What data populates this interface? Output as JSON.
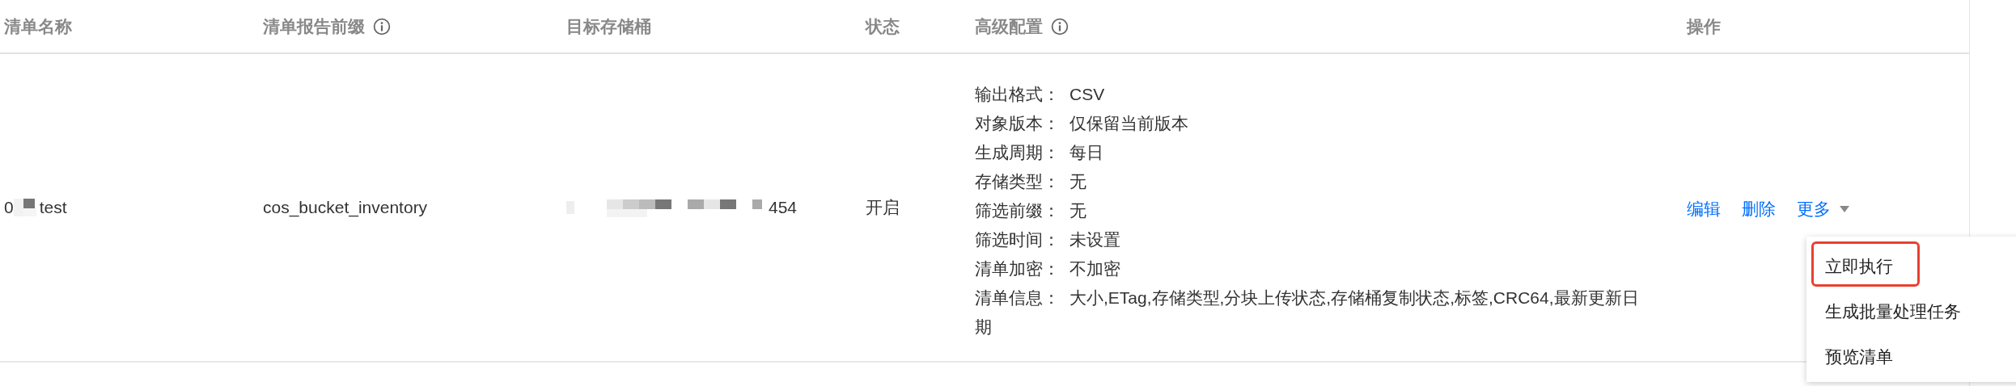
{
  "table": {
    "columns": [
      {
        "label": "清单名称",
        "info": false
      },
      {
        "label": "清单报告前缀",
        "info": true
      },
      {
        "label": "目标存储桶",
        "info": false
      },
      {
        "label": "状态",
        "info": false
      },
      {
        "label": "高级配置",
        "info": true
      },
      {
        "label": "操作",
        "info": false
      }
    ],
    "rows": [
      {
        "name": {
          "visible_start": "0",
          "visible_end": "test"
        },
        "prefix": "cos_bucket_inventory",
        "bucket": {
          "visible_end": "454"
        },
        "status": "开启",
        "config": [
          {
            "label": "输出格式：",
            "value": "CSV"
          },
          {
            "label": "对象版本：",
            "value": "仅保留当前版本"
          },
          {
            "label": "生成周期：",
            "value": "每日"
          },
          {
            "label": "存储类型：",
            "value": "无"
          },
          {
            "label": "筛选前缀：",
            "value": "无"
          },
          {
            "label": "筛选时间：",
            "value": "未设置"
          },
          {
            "label": "清单加密：",
            "value": "不加密"
          },
          {
            "label": "清单信息：",
            "value": "大小,ETag,存储类型,分块上传状态,存储桶复制状态,标签,CRC64,最新更新日期"
          }
        ],
        "actions": [
          {
            "label": "编辑",
            "kind": "link"
          },
          {
            "label": "删除",
            "kind": "link"
          },
          {
            "label": "更多",
            "kind": "dropdown",
            "expanded": true
          }
        ],
        "menu": [
          {
            "label": "立即执行",
            "marked": true
          },
          {
            "label": "生成批量处理任务",
            "marked": false
          },
          {
            "label": "预览清单",
            "marked": false
          }
        ]
      }
    ]
  }
}
